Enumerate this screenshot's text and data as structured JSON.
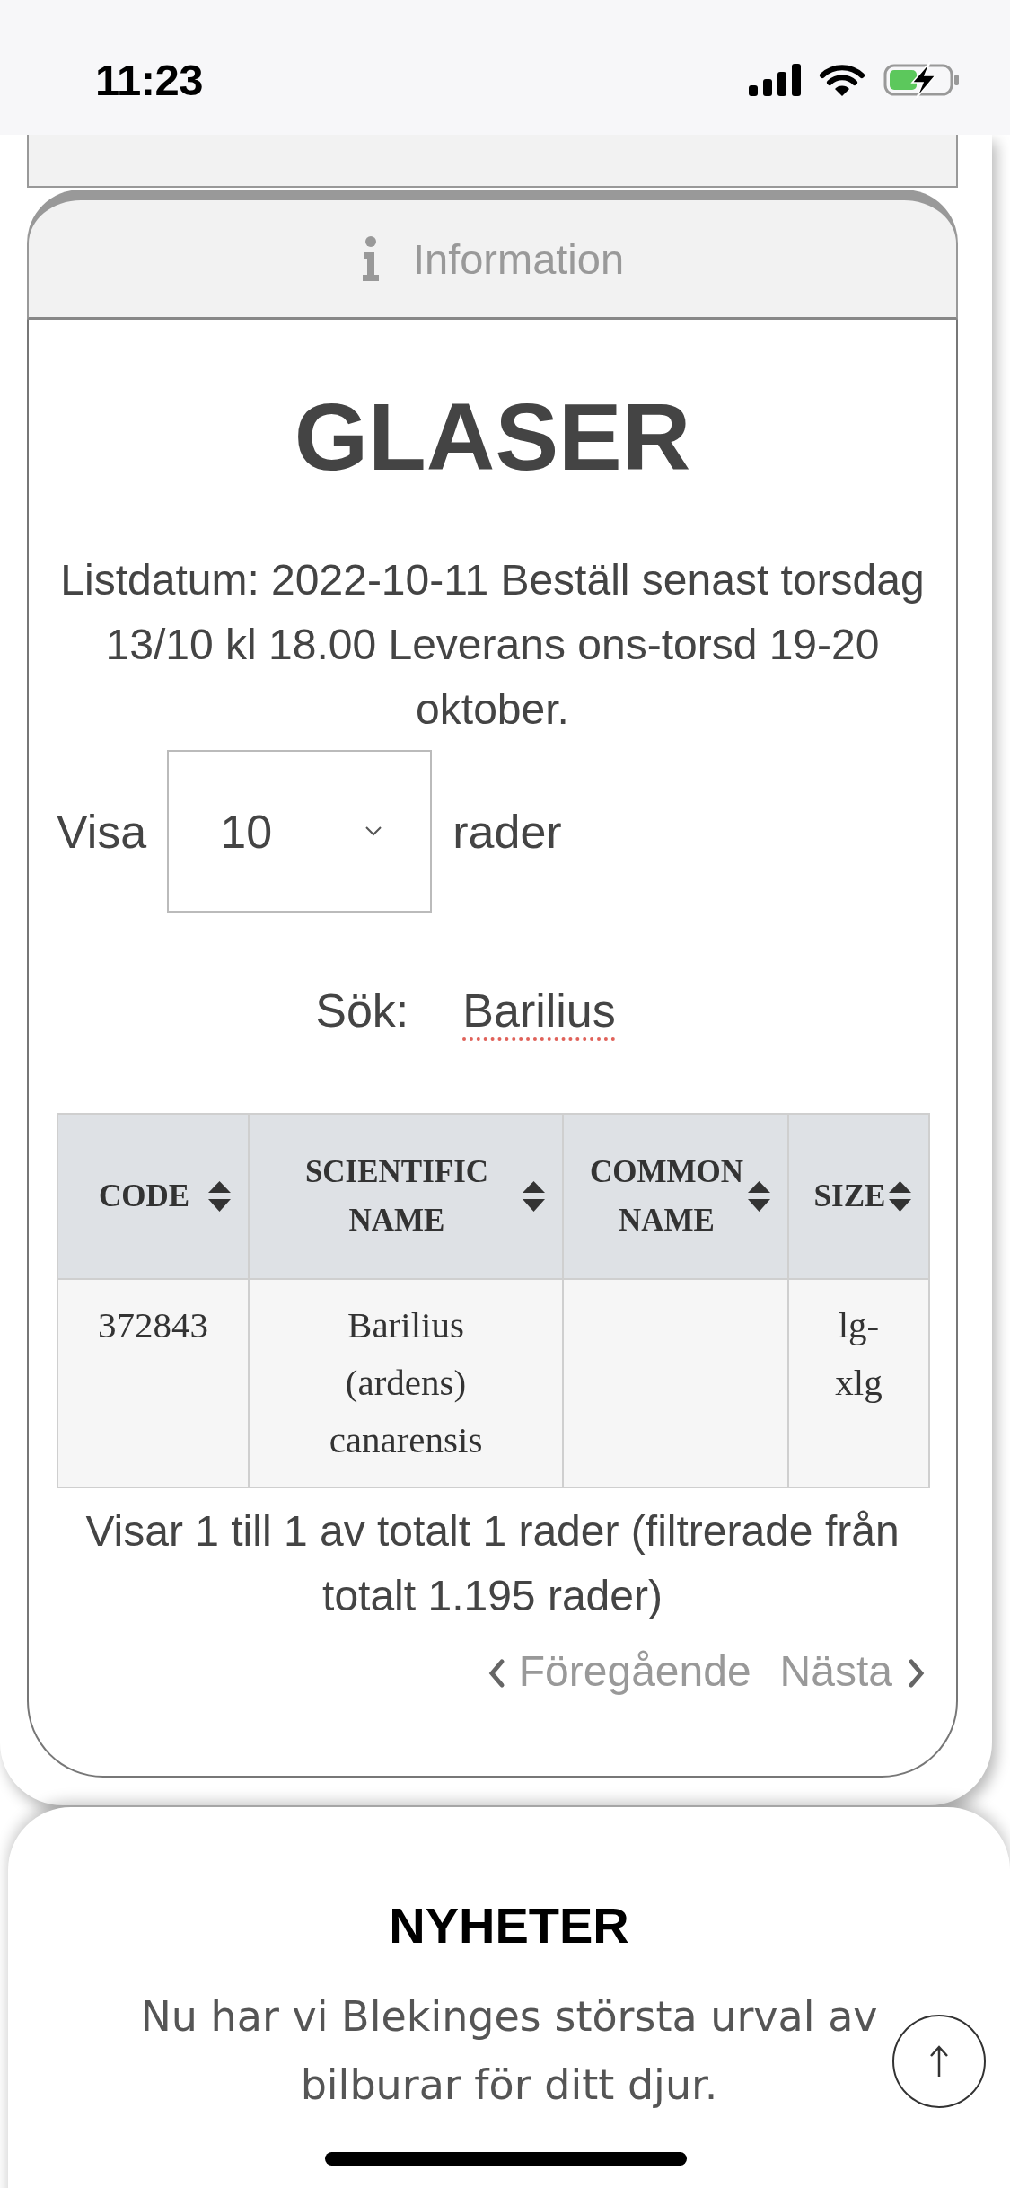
{
  "status_bar": {
    "time": "11:23"
  },
  "section": {
    "header": {
      "label": "Information",
      "expanded": true
    },
    "title": "GLASER",
    "intro": "Listdatum: 2022-10-11 Beställ senast torsdag 13/10 kl 18.00 Leverans ons-torsd 19-20 oktober.",
    "length_menu": {
      "label": "Visa",
      "value": "10",
      "suffix": "rader"
    },
    "search": {
      "label": "Sök:",
      "value": "Barilius",
      "misspelled": true
    },
    "table": {
      "columns": [
        {
          "label": "CODE"
        },
        {
          "label": "SCIENTIFIC NAME"
        },
        {
          "label": "COMMON NAME"
        },
        {
          "label": "SIZE"
        }
      ],
      "rows": [
        {
          "code": "372843",
          "scientific_name": "Barilius (ardens) canarensis",
          "size": "lg-xlg"
        }
      ]
    },
    "info": "Visar 1 till 1 av totalt 1 rader (filtrerade från totalt 1.195 rader)",
    "pagination": {
      "previous": {
        "label": "Föregående",
        "disabled": true
      },
      "next": {
        "label": "Nästa",
        "disabled": true
      }
    }
  },
  "news": {
    "title": "NYHETER",
    "text": "Nu har vi Blekinges största urval av bilburar för ditt djur."
  }
}
